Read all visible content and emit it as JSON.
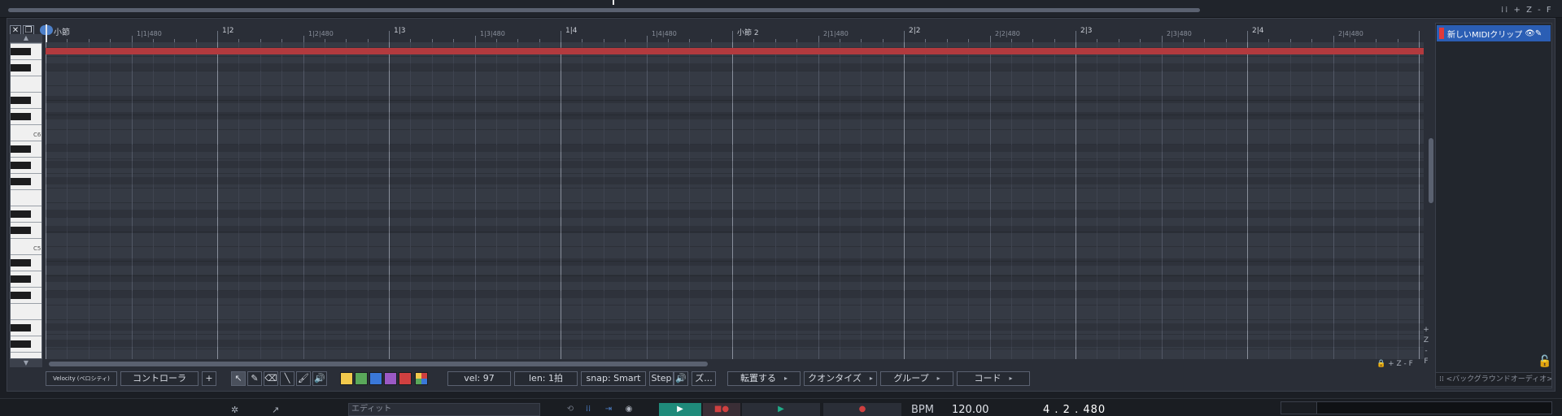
{
  "top": {
    "right_controls": "⁞⁞ + Z - F"
  },
  "window": {
    "close_icon": "✕",
    "detach_icon": "❐"
  },
  "piano": {
    "up_arrow": "▲",
    "down_arrow": "▼",
    "octave_labels": [
      "C6",
      "C5",
      "C4"
    ]
  },
  "ruler": {
    "bar_label": "小節",
    "labels": [
      {
        "text": "1|1|480",
        "sub": true
      },
      {
        "text": "1|2",
        "sub": false
      },
      {
        "text": "1|2|480",
        "sub": true
      },
      {
        "text": "1|3",
        "sub": false
      },
      {
        "text": "1|3|480",
        "sub": true
      },
      {
        "text": "1|4",
        "sub": false
      },
      {
        "text": "1|4|480",
        "sub": true
      },
      {
        "text": "小節 2",
        "sub": false
      },
      {
        "text": "2|1|480",
        "sub": true
      },
      {
        "text": "2|2",
        "sub": false
      },
      {
        "text": "2|2|480",
        "sub": true
      },
      {
        "text": "2|3",
        "sub": false
      },
      {
        "text": "2|3|480",
        "sub": true
      },
      {
        "text": "2|4",
        "sub": false
      },
      {
        "text": "2|4|480",
        "sub": true
      }
    ]
  },
  "zoom": {
    "vertical": [
      "+",
      "Z",
      "-",
      "F"
    ],
    "horizontal": "🔒 + Z - F"
  },
  "toolbar": {
    "velocity": "Velocity (ベロシティ)",
    "controller": "コントローラ",
    "add": "+",
    "tools": [
      {
        "name": "pointer-tool",
        "glyph": "↖"
      },
      {
        "name": "pencil-tool",
        "glyph": "✎"
      },
      {
        "name": "eraser-tool",
        "glyph": "⌫"
      },
      {
        "name": "line-tool",
        "glyph": "╲"
      },
      {
        "name": "brush-tool",
        "glyph": "🖌"
      },
      {
        "name": "speaker-tool",
        "glyph": "🔊"
      }
    ],
    "swatches": [
      "#f2c94c",
      "#5aa85a",
      "#3a78d8",
      "#9b59c4",
      "#d04040"
    ],
    "vel": "vel: 97",
    "len": "len: 1拍",
    "snap": "snap: Smart",
    "step": "Step",
    "step_speaker": "🔊",
    "z_button": "ズ...",
    "transpose": "転置する",
    "quantize": "クオンタイズ",
    "group": "グループ",
    "chord": "コード"
  },
  "clips": {
    "item_label": "新しいMIDIクリップ",
    "item_icons": "👁✎",
    "lock": "🔓",
    "background_audio": "⁞⁞ <バックグラウンドオーディオ>"
  },
  "transport": {
    "edit_placeholder": "エディット",
    "bpm_label": "BPM",
    "bpm_value": "120.00",
    "position": "4 . 2 . 480"
  }
}
